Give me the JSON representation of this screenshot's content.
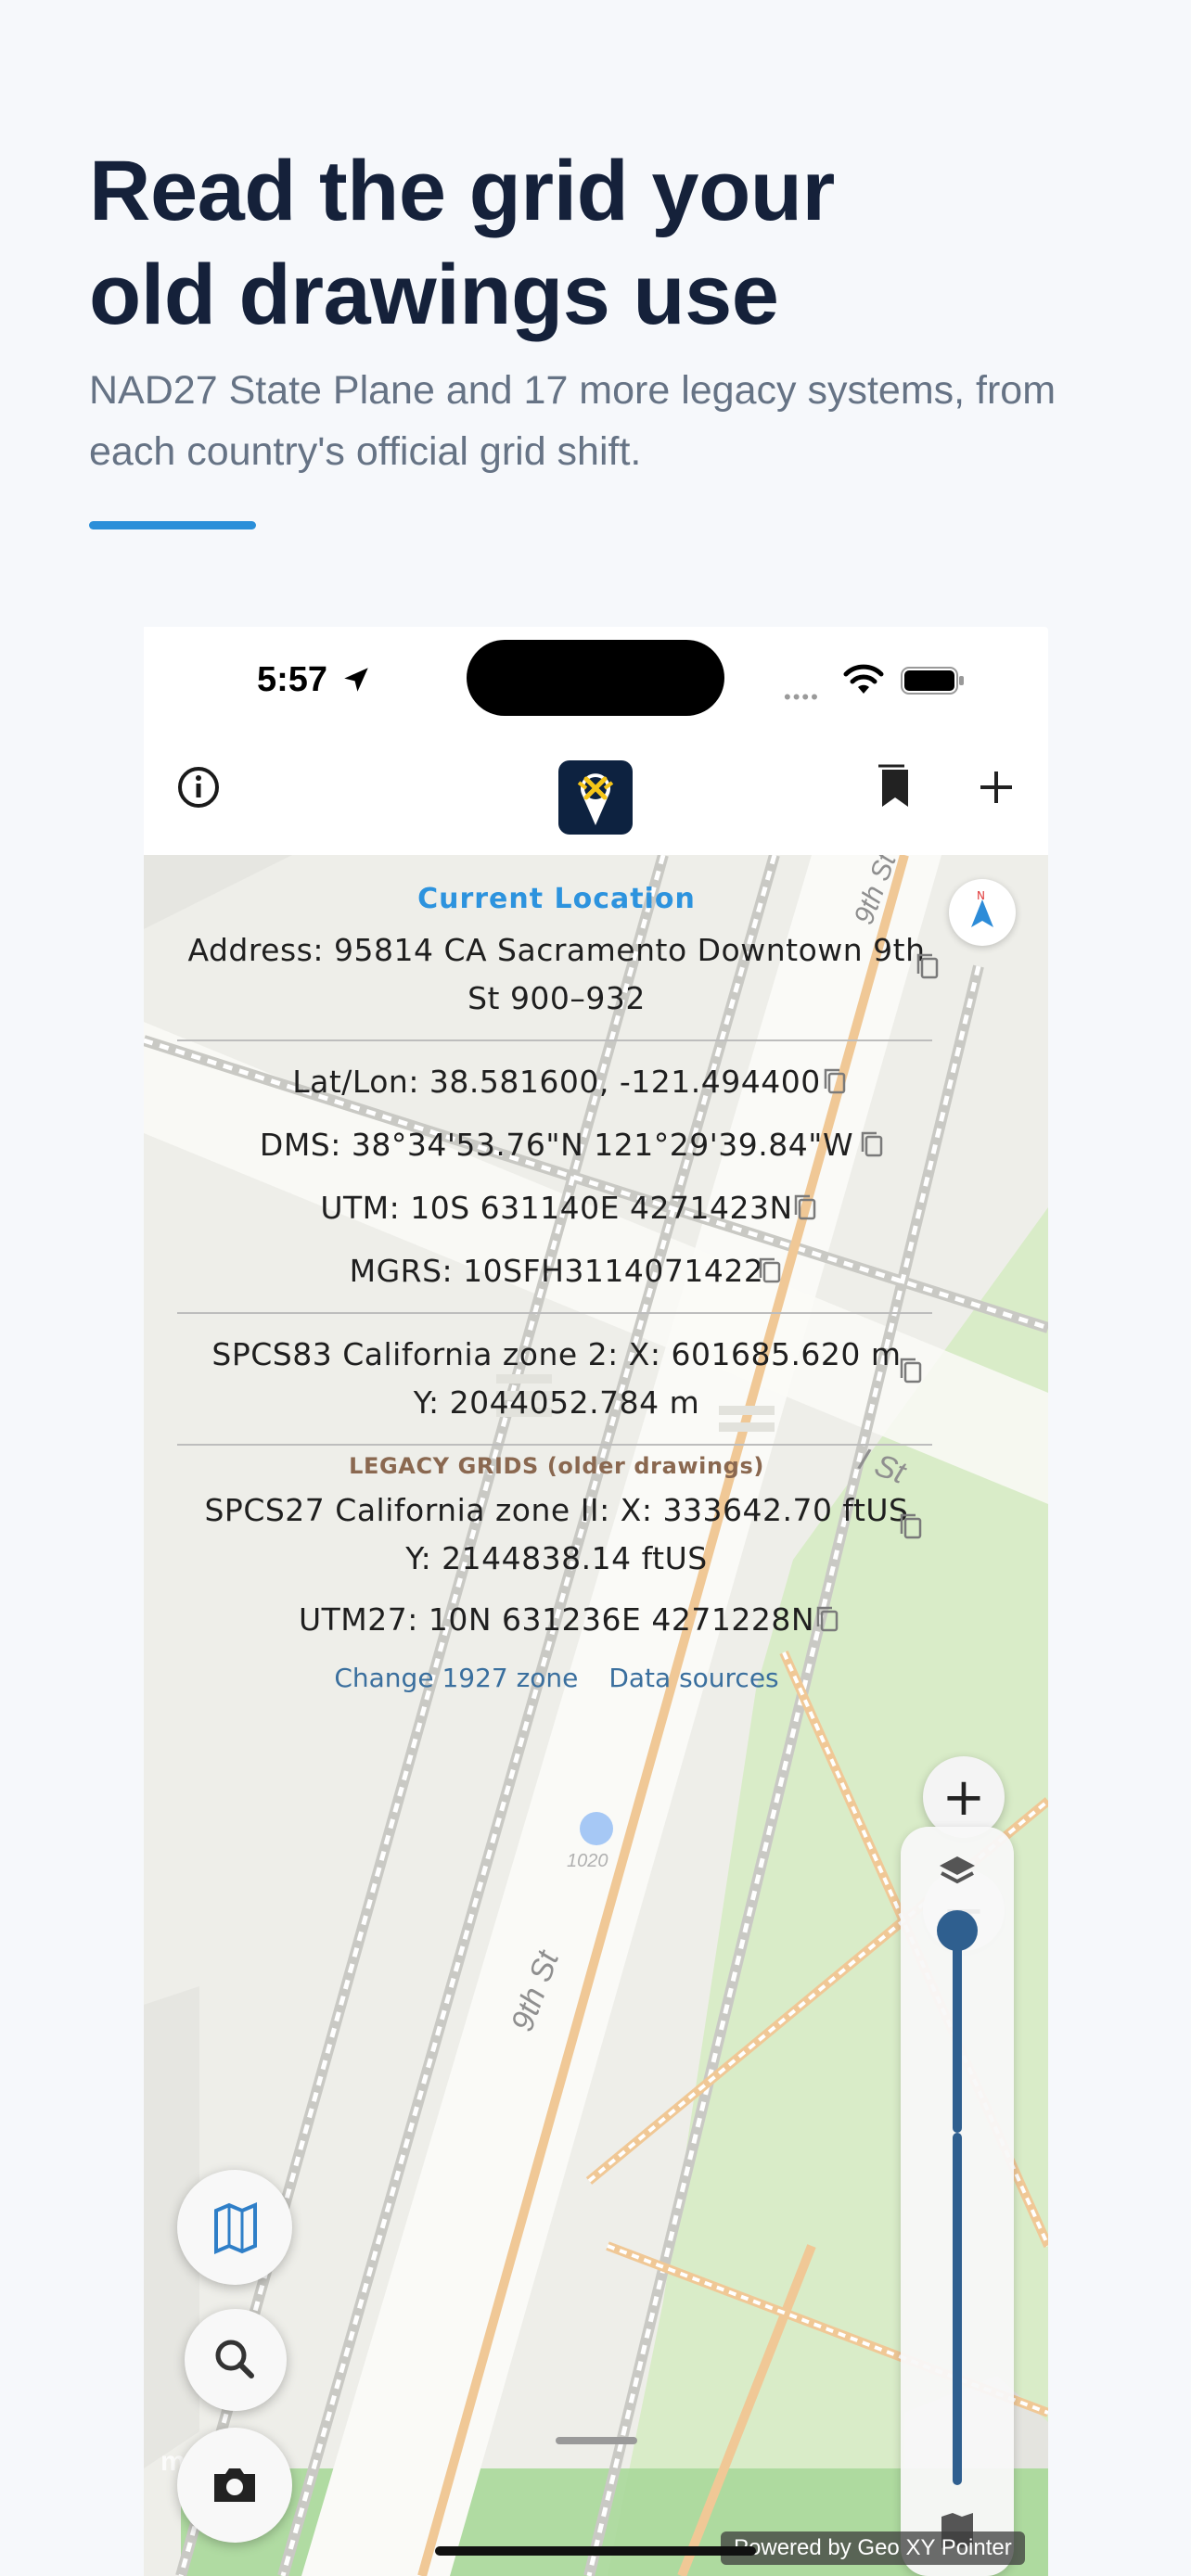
{
  "promo": {
    "headline_line1": "Read the grid your",
    "headline_line2": "old drawings use",
    "subtitle": "NAD27 State Plane and 17 more legacy systems, from each country's official grid shift."
  },
  "status_bar": {
    "time": "5:57",
    "dots": "••••"
  },
  "nav": {
    "add_label": "+"
  },
  "panel": {
    "title": "Current Location",
    "address": "Address: 95814 CA Sacramento Downtown 9th St 900–932",
    "latlon": "Lat/Lon: 38.581600, -121.494400",
    "dms": "DMS: 38°34'53.76\"N 121°29'39.84\"W",
    "utm": "UTM: 10S 631140E 4271423N",
    "mgrs": "MGRS: 10SFH3114071422",
    "spcs83": "SPCS83 California zone 2: X: 601685.620 m  Y: 2044052.784 m",
    "legacy_title": "LEGACY GRIDS (older drawings)",
    "spcs27": "SPCS27 California zone II: X: 333642.70 ftUS  Y: 2144838.14 ftUS",
    "utm27": "UTM27: 10N 631236E 4271228N",
    "change_zone": "Change 1927 zone",
    "data_sources": "Data sources"
  },
  "map": {
    "street_9th": "9th St",
    "street_9th_top": "9th St",
    "street_i": "I St",
    "address_1020": "1020",
    "powered_by": "Powered by Geo XY Pointer",
    "mapbox": "mapbox",
    "zoom_in": "+",
    "zoom_out": "−"
  },
  "colors": {
    "accent": "#2b8fd9",
    "headline": "#15213a",
    "legacy": "#8a6850",
    "slider": "#2f5f8f",
    "park": "#d9ecc8"
  },
  "icons": [
    "info-icon",
    "app-logo-icon",
    "bookmarks-icon",
    "add-icon",
    "compass-icon",
    "copy-icon",
    "layers-icon",
    "map-icon",
    "search-icon",
    "camera-icon"
  ]
}
